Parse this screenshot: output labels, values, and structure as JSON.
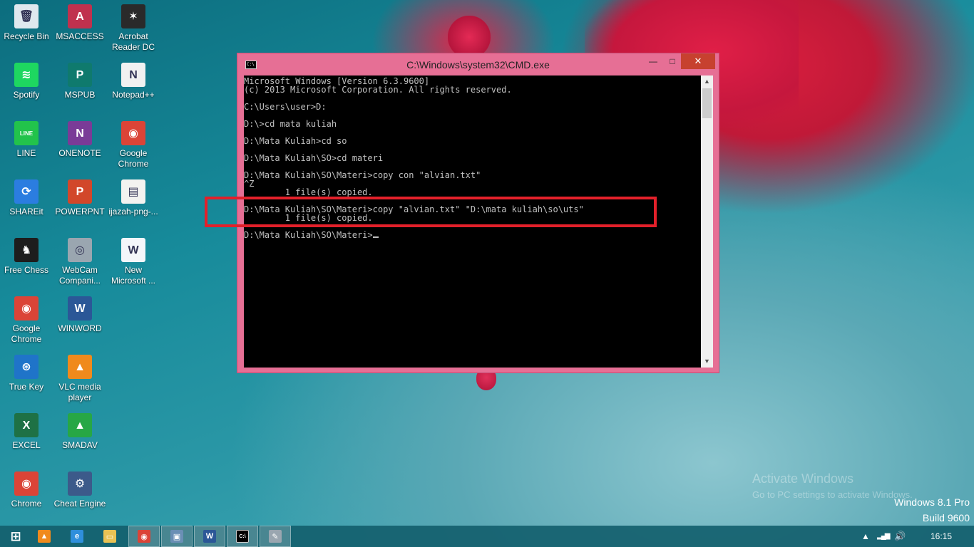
{
  "desktop_icons": [
    {
      "label": "Recycle Bin",
      "icon": "recycle-bin-icon",
      "color": "#dfe8ee",
      "glyph": "🗑"
    },
    {
      "label": "MSACCESS",
      "icon": "msaccess-icon",
      "color": "#c0314e",
      "glyph": "A"
    },
    {
      "label": "Acrobat Reader DC",
      "icon": "acrobat-reader-icon",
      "color": "#2a2a2a",
      "glyph": "✶"
    },
    {
      "label": "Spotify",
      "icon": "spotify-icon",
      "color": "#1ed760",
      "glyph": "≋"
    },
    {
      "label": "MSPUB",
      "icon": "mspub-icon",
      "color": "#0f7a6d",
      "glyph": "P"
    },
    {
      "label": "Notepad++",
      "icon": "notepadpp-icon",
      "color": "#f1f1f1",
      "glyph": "N"
    },
    {
      "label": "LINE",
      "icon": "line-icon",
      "color": "#22c34b",
      "glyph": "LINE"
    },
    {
      "label": "ONENOTE",
      "icon": "onenote-icon",
      "color": "#7a3b97",
      "glyph": "N"
    },
    {
      "label": "Google Chrome",
      "icon": "chrome-icon",
      "color": "#db4437",
      "glyph": "◉"
    },
    {
      "label": "SHAREit",
      "icon": "shareit-icon",
      "color": "#2b7de0",
      "glyph": "⟳"
    },
    {
      "label": "POWERPNT",
      "icon": "powerpoint-icon",
      "color": "#d2472a",
      "glyph": "P"
    },
    {
      "label": "ijazah-png-...",
      "icon": "image-file-icon",
      "color": "#f3f3f0",
      "glyph": "▤"
    },
    {
      "label": "Free Chess",
      "icon": "chess-icon",
      "color": "#1d1d1d",
      "glyph": "♞"
    },
    {
      "label": "WebCam Compani...",
      "icon": "webcam-icon",
      "color": "#9aa6b0",
      "glyph": "◎"
    },
    {
      "label": "New Microsoft ...",
      "icon": "word-document-icon",
      "color": "#f4f6fa",
      "glyph": "W"
    },
    {
      "label": "Google Chrome",
      "icon": "chrome-icon",
      "color": "#db4437",
      "glyph": "◉"
    },
    {
      "label": "WINWORD",
      "icon": "word-icon",
      "color": "#2b5797",
      "glyph": "W"
    },
    {
      "label": "True Key",
      "icon": "true-key-icon",
      "color": "#1f74c9",
      "glyph": "⊛"
    },
    {
      "label": "VLC media player",
      "icon": "vlc-icon",
      "color": "#f08a1c",
      "glyph": "▲"
    },
    {
      "label": "EXCEL",
      "icon": "excel-icon",
      "color": "#1e7145",
      "glyph": "X"
    },
    {
      "label": "SMADAV",
      "icon": "smadav-icon",
      "color": "#27a745",
      "glyph": "▲"
    },
    {
      "label": "Chrome",
      "icon": "chrome-icon",
      "color": "#db4437",
      "glyph": "◉"
    },
    {
      "label": "Cheat Engine",
      "icon": "cheat-engine-icon",
      "color": "#3c5a8a",
      "glyph": "⚙"
    }
  ],
  "cmd": {
    "title": "C:\\Windows\\system32\\CMD.exe",
    "icon_text": "C:\\",
    "controls": {
      "minimize": "—",
      "maximize": "□",
      "close": "✕"
    },
    "lines": [
      "Microsoft Windows [Version 6.3.9600]",
      "(c) 2013 Microsoft Corporation. All rights reserved.",
      "",
      "C:\\Users\\user>D:",
      "",
      "D:\\>cd mata kuliah",
      "",
      "D:\\Mata Kuliah>cd so",
      "",
      "D:\\Mata Kuliah\\SO>cd materi",
      "",
      "D:\\Mata Kuliah\\SO\\Materi>copy con \"alvian.txt\"",
      "^Z",
      "        1 file(s) copied.",
      "",
      "D:\\Mata Kuliah\\SO\\Materi>copy \"alvian.txt\" \"D:\\mata kuliah\\so\\uts\"",
      "        1 file(s) copied.",
      "",
      "D:\\Mata Kuliah\\SO\\Materi>"
    ]
  },
  "watermark": {
    "line1": "Activate Windows",
    "line2": "Go to PC settings to activate Windows."
  },
  "build": {
    "edition": "Windows 8.1 Pro",
    "build": "Build 9600"
  },
  "taskbar": {
    "items": [
      {
        "name": "start-button",
        "icon": "windows-logo-icon",
        "color": "#ffffff",
        "glyph": "⊞",
        "active": false
      },
      {
        "name": "taskbar-vlc",
        "icon": "vlc-icon",
        "color": "#f08a1c",
        "glyph": "▲",
        "active": false
      },
      {
        "name": "taskbar-ie",
        "icon": "internet-explorer-icon",
        "color": "#2f8fdc",
        "glyph": "e",
        "active": false
      },
      {
        "name": "taskbar-file-explorer",
        "icon": "folder-icon",
        "color": "#e9c254",
        "glyph": "▭",
        "active": false
      },
      {
        "name": "taskbar-chrome",
        "icon": "chrome-icon",
        "color": "#db4437",
        "glyph": "◉",
        "active": true
      },
      {
        "name": "taskbar-window",
        "icon": "window-icon",
        "color": "#6a8fb5",
        "glyph": "▣",
        "active": true
      },
      {
        "name": "taskbar-word",
        "icon": "word-icon",
        "color": "#2b5797",
        "glyph": "W",
        "active": true
      },
      {
        "name": "taskbar-cmd",
        "icon": "cmd-icon",
        "color": "#000000",
        "glyph": "C:\\",
        "active": true
      },
      {
        "name": "taskbar-paint",
        "icon": "paint-icon",
        "color": "#9aa6b0",
        "glyph": "✎",
        "active": true
      }
    ],
    "tray": {
      "show_hidden": "▲",
      "signal": "▂▄▆",
      "volume": "🔊",
      "time": "16:15"
    }
  }
}
